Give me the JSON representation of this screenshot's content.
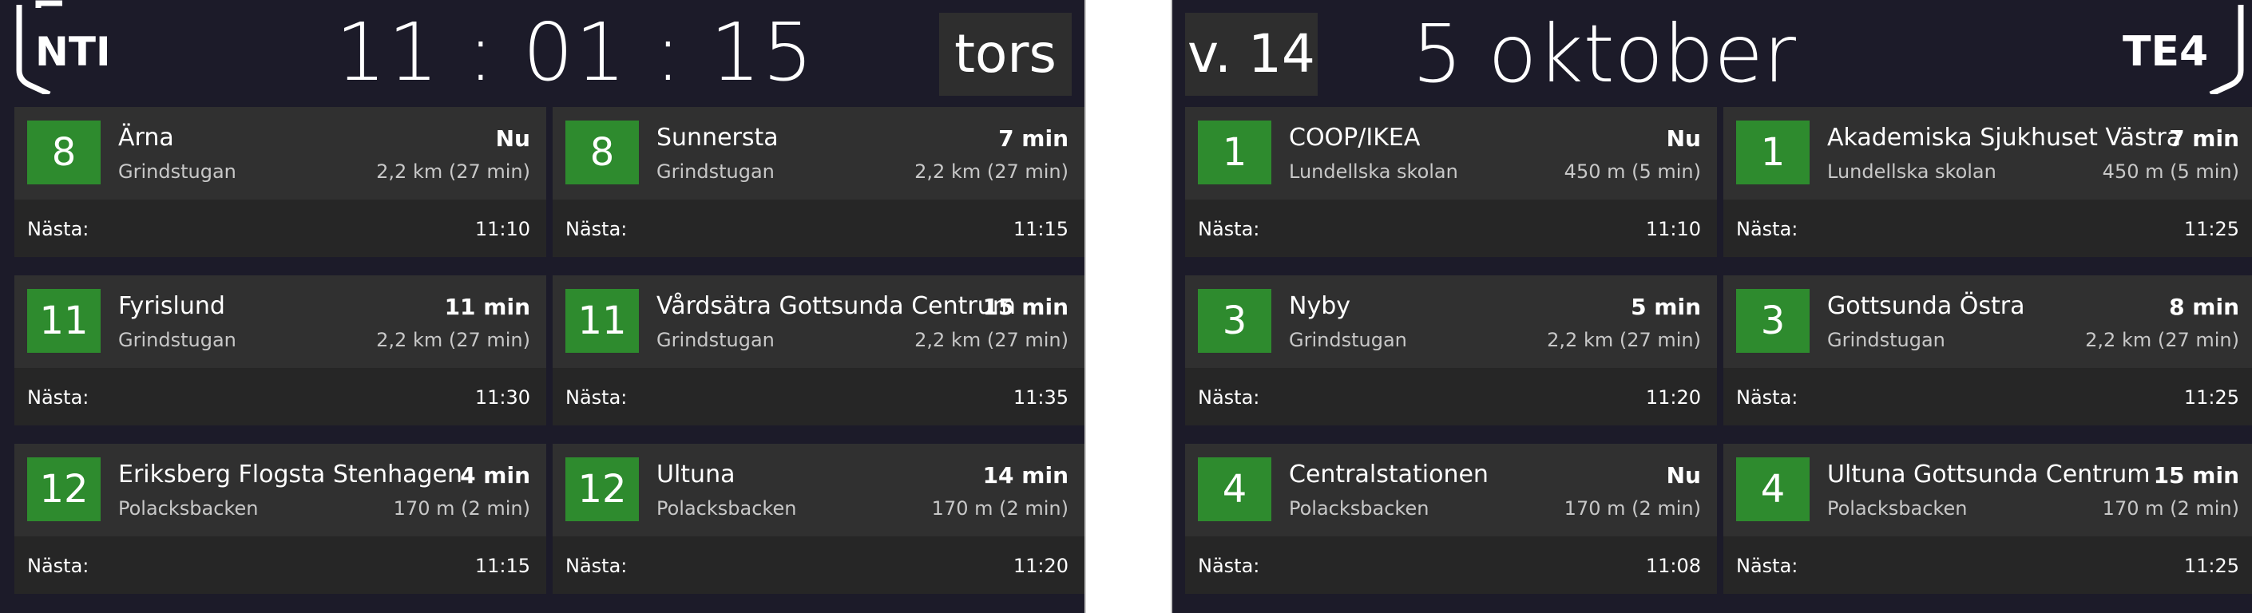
{
  "colors": {
    "background": "#1c1b29",
    "card": "#262626",
    "card_top": "#303030",
    "line_badge": "#2e8b2e",
    "divider": "#ffffff"
  },
  "left": {
    "logo": "NTI",
    "clock": "11 : 01 : 15",
    "weekday": "tors",
    "departures": [
      {
        "line": "8",
        "destination": "Ärna",
        "time": "Nu",
        "stop": "Grindstugan",
        "distance": "2,2 km (27 min)",
        "next_label": "Nästa:",
        "next": "11:10"
      },
      {
        "line": "8",
        "destination": "Sunnersta",
        "time": "7 min",
        "stop": "Grindstugan",
        "distance": "2,2 km (27 min)",
        "next_label": "Nästa:",
        "next": "11:15"
      },
      {
        "line": "11",
        "destination": "Fyrislund",
        "time": "11 min",
        "stop": "Grindstugan",
        "distance": "2,2 km (27 min)",
        "next_label": "Nästa:",
        "next": "11:30"
      },
      {
        "line": "11",
        "destination": "Vårdsätra Gottsunda Centrum",
        "time": "15 min",
        "stop": "Grindstugan",
        "distance": "2,2 km (27 min)",
        "next_label": "Nästa:",
        "next": "11:35"
      },
      {
        "line": "12",
        "destination": "Eriksberg Flogsta Stenhagen",
        "time": "4 min",
        "stop": "Polacksbacken",
        "distance": "170 m (2 min)",
        "next_label": "Nästa:",
        "next": "11:15"
      },
      {
        "line": "12",
        "destination": "Ultuna",
        "time": "14 min",
        "stop": "Polacksbacken",
        "distance": "170 m (2 min)",
        "next_label": "Nästa:",
        "next": "11:20"
      }
    ]
  },
  "right": {
    "logo": "TE4",
    "week": "v. 14",
    "date": "5 oktober",
    "departures": [
      {
        "line": "1",
        "destination": "COOP/IKEA",
        "time": "Nu",
        "stop": "Lundellska skolan",
        "distance": "450 m (5 min)",
        "next_label": "Nästa:",
        "next": "11:10"
      },
      {
        "line": "1",
        "destination": "Akademiska Sjukhuset Västra",
        "time": "7 min",
        "stop": "Lundellska skolan",
        "distance": "450 m (5 min)",
        "next_label": "Nästa:",
        "next": "11:25"
      },
      {
        "line": "3",
        "destination": "Nyby",
        "time": "5 min",
        "stop": "Grindstugan",
        "distance": "2,2 km (27 min)",
        "next_label": "Nästa:",
        "next": "11:20"
      },
      {
        "line": "3",
        "destination": "Gottsunda Östra",
        "time": "8 min",
        "stop": "Grindstugan",
        "distance": "2,2 km (27 min)",
        "next_label": "Nästa:",
        "next": "11:25"
      },
      {
        "line": "4",
        "destination": "Centralstationen",
        "time": "Nu",
        "stop": "Polacksbacken",
        "distance": "170 m (2 min)",
        "next_label": "Nästa:",
        "next": "11:08"
      },
      {
        "line": "4",
        "destination": "Ultuna Gottsunda Centrum",
        "time": "15 min",
        "stop": "Polacksbacken",
        "distance": "170 m (2 min)",
        "next_label": "Nästa:",
        "next": "11:25"
      }
    ]
  }
}
